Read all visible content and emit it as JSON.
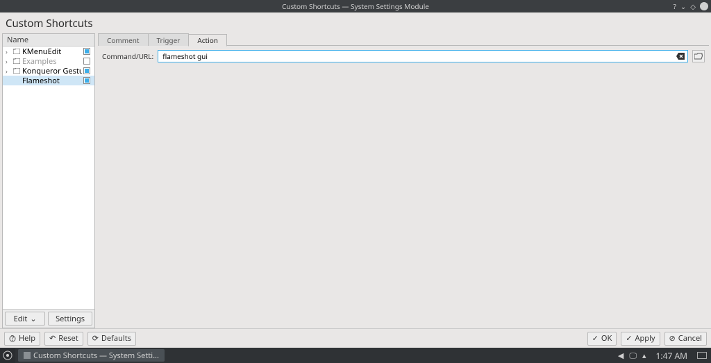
{
  "titlebar": {
    "title": "Custom Shortcuts — System Settings Module"
  },
  "heading": "Custom Shortcuts",
  "tree": {
    "header": "Name",
    "items": [
      {
        "label": "KMenuEdit",
        "checked": true,
        "hasChildren": true,
        "isFolder": true
      },
      {
        "label": "Examples",
        "checked": false,
        "hasChildren": true,
        "isFolder": true,
        "disabled": true
      },
      {
        "label": "Konqueror Gestures",
        "checked": true,
        "hasChildren": true,
        "isFolder": true
      },
      {
        "label": "Flameshot",
        "checked": true,
        "selected": true,
        "hasChildren": false,
        "isFolder": false
      }
    ]
  },
  "leftButtons": {
    "edit": "Edit",
    "settings": "Settings"
  },
  "tabs": [
    {
      "label": "Comment",
      "active": false
    },
    {
      "label": "Trigger",
      "active": false
    },
    {
      "label": "Action",
      "active": true
    }
  ],
  "action": {
    "label": "Command/URL:",
    "value": "flameshot gui"
  },
  "footer": {
    "help": "Help",
    "reset": "Reset",
    "defaults": "Defaults",
    "ok": "OK",
    "apply": "Apply",
    "cancel": "Cancel"
  },
  "taskbar": {
    "task": "Custom Shortcuts — System Setti...",
    "clock": "1:47 AM"
  }
}
